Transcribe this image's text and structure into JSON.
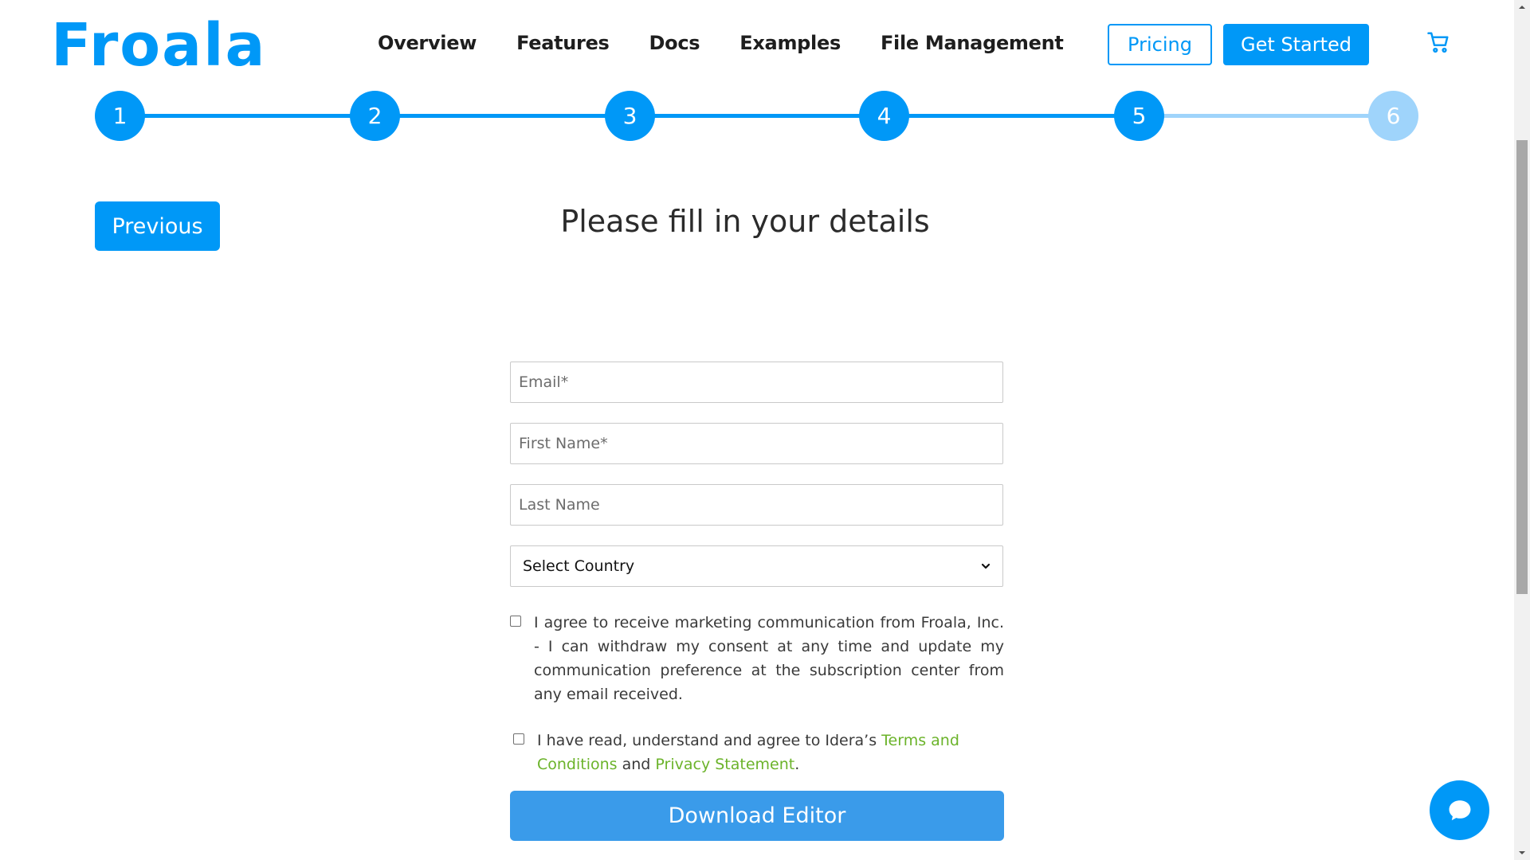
{
  "header": {
    "logo": "Froala",
    "nav": [
      "Overview",
      "Features",
      "Docs",
      "Examples",
      "File Management"
    ],
    "pricing_label": "Pricing",
    "get_started_label": "Get Started",
    "cart_icon": "cart-icon"
  },
  "stepper": {
    "steps": [
      "1",
      "2",
      "3",
      "4",
      "5",
      "6"
    ],
    "current_step": 5
  },
  "previous_label": "Previous",
  "title": "Please fill in your details",
  "form": {
    "email_placeholder": "Email*",
    "first_name_placeholder": "First Name*",
    "last_name_placeholder": "Last Name",
    "country_selected": "Select Country",
    "marketing_consent": "I agree to receive marketing communication from Froala, Inc. - I can withdraw my consent at any time and update my communication preference at the subscription center from any email received.",
    "terms_prefix": "I have read, understand and agree to Idera’s ",
    "terms_link": "Terms and Conditions",
    "terms_and": " and ",
    "privacy_link": "Privacy Statement",
    "terms_suffix": ".",
    "download_label": "Download Editor"
  },
  "colors": {
    "brand": "#0098f7",
    "step_inactive": "#9fd4fb",
    "link": "#6bb32a",
    "download": "#3a9bea"
  }
}
